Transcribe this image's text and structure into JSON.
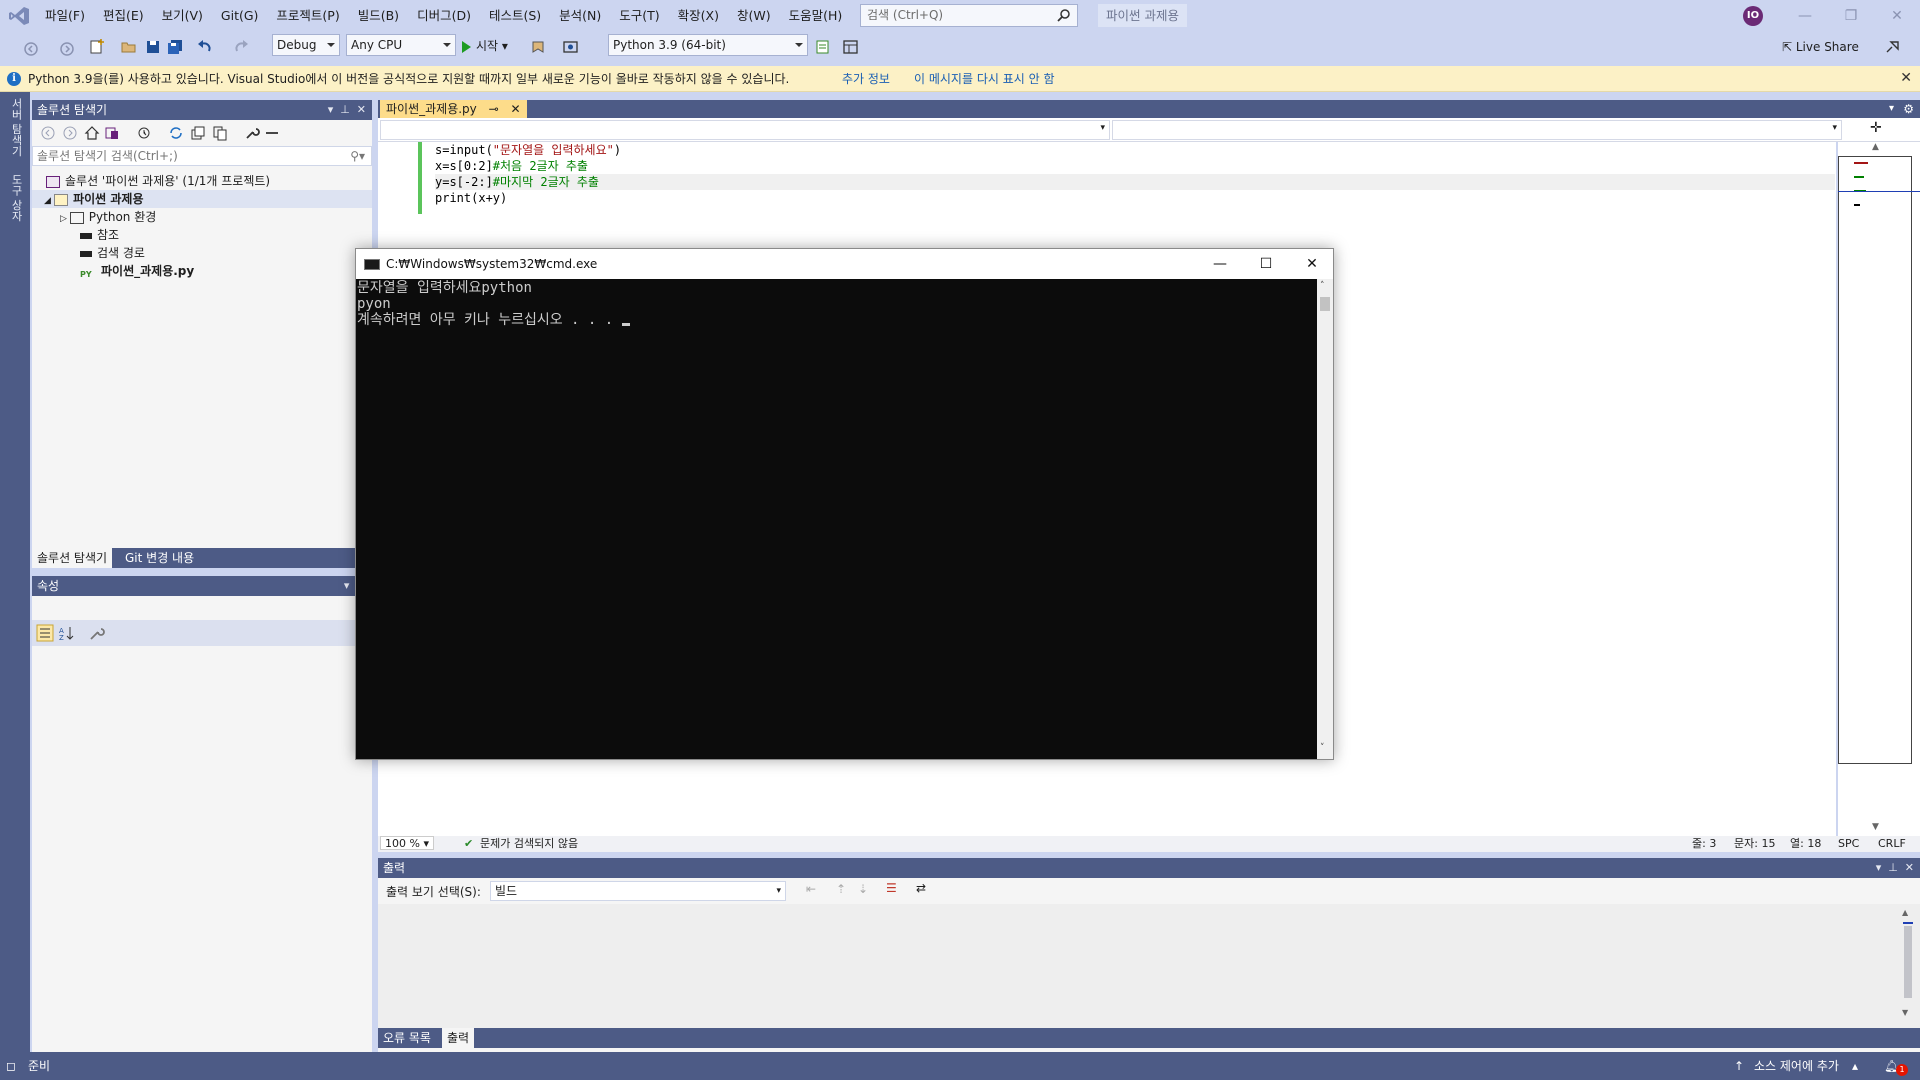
{
  "menubar": {
    "items": [
      "파일(F)",
      "편집(E)",
      "보기(V)",
      "Git(G)",
      "프로젝트(P)",
      "빌드(B)",
      "디버그(D)",
      "테스트(S)",
      "분석(N)",
      "도구(T)",
      "확장(X)",
      "창(W)",
      "도움말(H)"
    ],
    "search_placeholder": "검색 (Ctrl+Q)",
    "solution_name": "파이썬 과제용",
    "avatar_initials": "IO"
  },
  "toolbar": {
    "config": "Debug",
    "platform": "Any CPU",
    "start_label": "시작",
    "interpreter": "Python 3.9 (64-bit)",
    "live_share": "Live Share"
  },
  "infobar": {
    "message": "Python 3.9을(를) 사용하고 있습니다. Visual Studio에서 이 버전을 공식적으로 지원할 때까지 일부 새로운 기능이 올바로 작동하지 않을 수 있습니다.",
    "link_more": "추가 정보",
    "link_dont_show": "이 메시지를 다시 표시 안 함"
  },
  "left_strip": {
    "tab1": "서버 탐색기",
    "tab2": "도구 상자"
  },
  "solution_explorer": {
    "title": "솔루션 탐색기",
    "search_placeholder": "솔루션 탐색기 검색(Ctrl+;)",
    "tree": [
      {
        "label": "솔루션 '파이썬 과제용' (1/1개 프로젝트)"
      },
      {
        "label": "파이썬 과제용"
      },
      {
        "label": "Python 환경"
      },
      {
        "label": "참조"
      },
      {
        "label": "검색 경로"
      },
      {
        "label": "파이썬_과제용.py"
      }
    ],
    "tab_solution": "솔루션 탐색기",
    "tab_git": "Git 변경 내용"
  },
  "properties": {
    "title": "속성"
  },
  "editor": {
    "file_tab": "파이썬_과제용.py",
    "lines": [
      {
        "code": "s=input(",
        "str": "\"문자열을 입력하세요\"",
        "tail": ")"
      },
      {
        "code": "x=s[0:2]",
        "comment": "#처음 2글자 추출"
      },
      {
        "code": "y=s[-2:]",
        "comment": "#마지막 2글자 추출"
      },
      {
        "code": "print(x+y)"
      }
    ],
    "zoom": "100 %",
    "issues": "문제가 검색되지 않음",
    "line": "줄: 3",
    "char": "문자: 15",
    "col": "열: 18",
    "spc": "SPC",
    "eol": "CRLF"
  },
  "output": {
    "title": "출력",
    "source_label": "출력 보기 선택(S):",
    "source_value": "빌드",
    "tab_errors": "오류 목록",
    "tab_output": "출력"
  },
  "statusbar": {
    "ready": "준비",
    "source_control": "소스 제어에 추가",
    "notifications": "1"
  },
  "cmd": {
    "title": "C:₩Windows₩system32₩cmd.exe",
    "lines": [
      "문자열을 입력하세요python",
      "pyon",
      "계속하려면 아무 키나 누르십시오 . . . "
    ]
  },
  "colors": {
    "chrome": "#CCD5F0",
    "panel_header": "#4d5b86",
    "infobar": "#FCF1C6",
    "tab_active": "#fddc8a",
    "console_bg": "#0c0c0c"
  }
}
